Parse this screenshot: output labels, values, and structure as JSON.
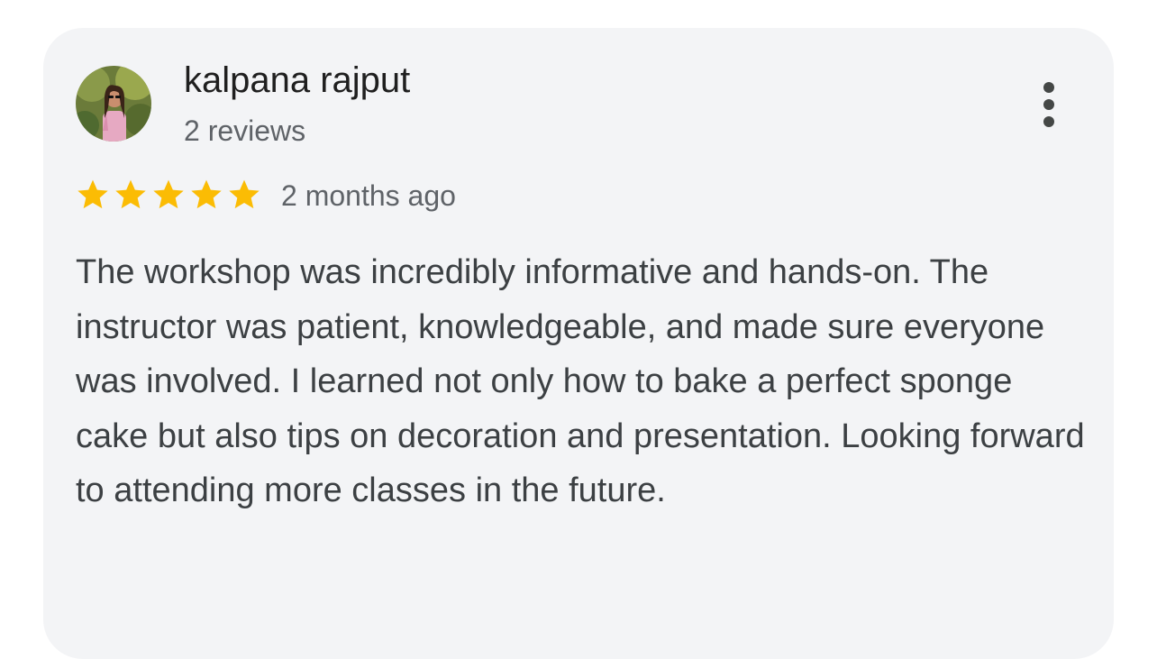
{
  "review": {
    "author": {
      "name": "kalpana rajput",
      "reviews_count": "2 reviews",
      "avatar_icon": "profile-photo"
    },
    "rating": 5,
    "max_rating": 5,
    "star_color": "#fbbc04",
    "time_ago": "2 months ago",
    "text": "The workshop was incredibly informative and hands-on. The instructor was patient, knowledgeable, and made sure everyone was involved. I learned not only how to bake a perfect sponge cake but also tips on decoration and presentation. Looking forward to attending more classes in the future.",
    "menu_icon": "more-vertical-icon"
  },
  "colors": {
    "card_background": "#f3f4f6",
    "name_text": "#1f1f1f",
    "secondary_text": "#5f6368",
    "body_text": "#3c4043"
  }
}
